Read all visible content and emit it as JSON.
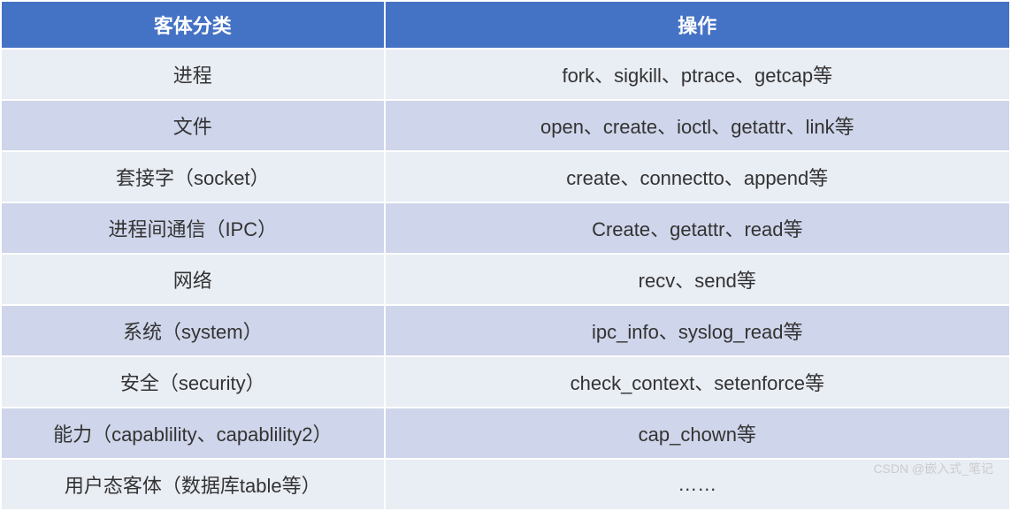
{
  "table": {
    "headers": {
      "category": "客体分类",
      "operation": "操作"
    },
    "rows": [
      {
        "category": "进程",
        "operation": "fork、sigkill、ptrace、getcap等"
      },
      {
        "category": "文件",
        "operation": "open、create、ioctl、getattr、link等"
      },
      {
        "category": "套接字（socket）",
        "operation": "create、connectto、append等"
      },
      {
        "category": "进程间通信（IPC）",
        "operation": "Create、getattr、read等"
      },
      {
        "category": "网络",
        "operation": "recv、send等"
      },
      {
        "category": "系统（system）",
        "operation": "ipc_info、syslog_read等"
      },
      {
        "category": "安全（security）",
        "operation": "check_context、setenforce等"
      },
      {
        "category": "能力（capablility、capablility2）",
        "operation": "cap_chown等"
      },
      {
        "category": "用户态客体（数据库table等）",
        "operation": "……"
      }
    ]
  },
  "watermark": "CSDN @嵌入式_笔记"
}
